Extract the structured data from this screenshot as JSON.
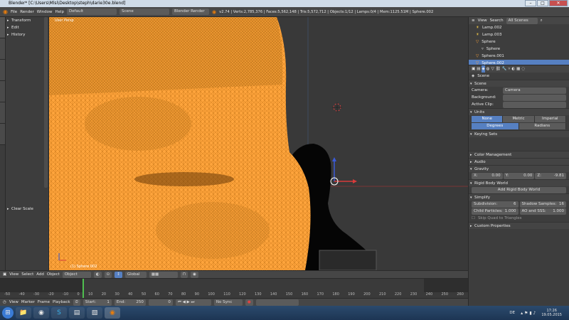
{
  "window": {
    "title": "Blender* [C:\\Users\\Mlsi\\Desktop\\steph\\darie30e.blend]"
  },
  "infobar": {
    "menus": [
      "File",
      "Render",
      "Window",
      "Help"
    ],
    "layout": "Default",
    "scene": "Scene",
    "engine": "Blender Render",
    "stats": "v2.74 | Verts:2,785,376 | Faces:5,562,148 | Tris:5,572,712 | Objects:1/12 | Lamps:0/4 | Mem:1125.51M | Sphere.002"
  },
  "toolpanel": {
    "sections": [
      "Transform",
      "Edit",
      "History"
    ],
    "clear_scale": "Clear Scale",
    "tabs": [
      "Tools",
      "Create",
      "Relations",
      "Animation",
      "Physics",
      "Grease Pencil"
    ]
  },
  "viewport": {
    "view_label": "User Persp",
    "object_label": "(1) Sphere.002"
  },
  "vp_toolbar": {
    "view": "View",
    "select": "Select",
    "add": "Add",
    "object": "Object",
    "mode": "Object Mode",
    "orientation": "Global"
  },
  "timeline": {
    "ticks": [
      "-50",
      "-40",
      "-30",
      "-20",
      "-10",
      "0",
      "10",
      "20",
      "30",
      "40",
      "50",
      "60",
      "70",
      "80",
      "90",
      "100",
      "110",
      "120",
      "130",
      "140",
      "150",
      "160",
      "170",
      "180",
      "190",
      "200",
      "210",
      "220",
      "230",
      "240",
      "250",
      "260"
    ]
  },
  "tl_toolbar": {
    "view": "View",
    "marker": "Marker",
    "frame": "Frame",
    "playback": "Playback",
    "start_label": "Start:",
    "start": "1",
    "end_label": "End:",
    "end": "250",
    "current": "0",
    "sync": "No Sync"
  },
  "outliner": {
    "view": "View",
    "search": "Search",
    "filter": "All Scenes",
    "items": [
      "Lamp.002",
      "Lamp.003",
      "Sphere",
      "Sphere",
      "Sphere.001",
      "Sphere.002"
    ]
  },
  "props": {
    "breadcrumb": "Scene",
    "scene_section": "Scene",
    "camera_label": "Camera:",
    "camera_value": "Camera",
    "background_label": "Background:",
    "active_clip_label": "Active Clip:",
    "units_section": "Units",
    "units_opts": [
      "None",
      "Metric",
      "Imperial"
    ],
    "angle_opts": [
      "Degrees",
      "Radians"
    ],
    "keying_section": "Keying Sets",
    "color_mgmt": "Color Management",
    "audio": "Audio",
    "gravity": "Gravity",
    "gx": "X:",
    "gx_val": "0.00",
    "gy": "Y:",
    "gy_val": "0.00",
    "gz": "Z:",
    "gz_val": "-9.81",
    "rigid_body": "Rigid Body World",
    "add_rigid": "Add Rigid Body World",
    "simplify": "Simplify",
    "subdivision": "Subdivision:",
    "subdivision_val": "6",
    "shadow_samples": "Shadow Samples:",
    "shadow_samples_val": "16",
    "child_particles": "Child Particles:",
    "child_particles_val": "1.000",
    "ao_sss": "AO and SSS:",
    "ao_sss_val": "1.000",
    "skip_quad": "Skip Quad to Triangles",
    "custom_props": "Custom Properties"
  },
  "taskbar": {
    "lang": "DE",
    "time": "17:26",
    "date": "19.05.2015"
  },
  "colors": {
    "selected_mesh": "#ffa43c",
    "accent": "#5680c2",
    "bg": "#393939"
  }
}
